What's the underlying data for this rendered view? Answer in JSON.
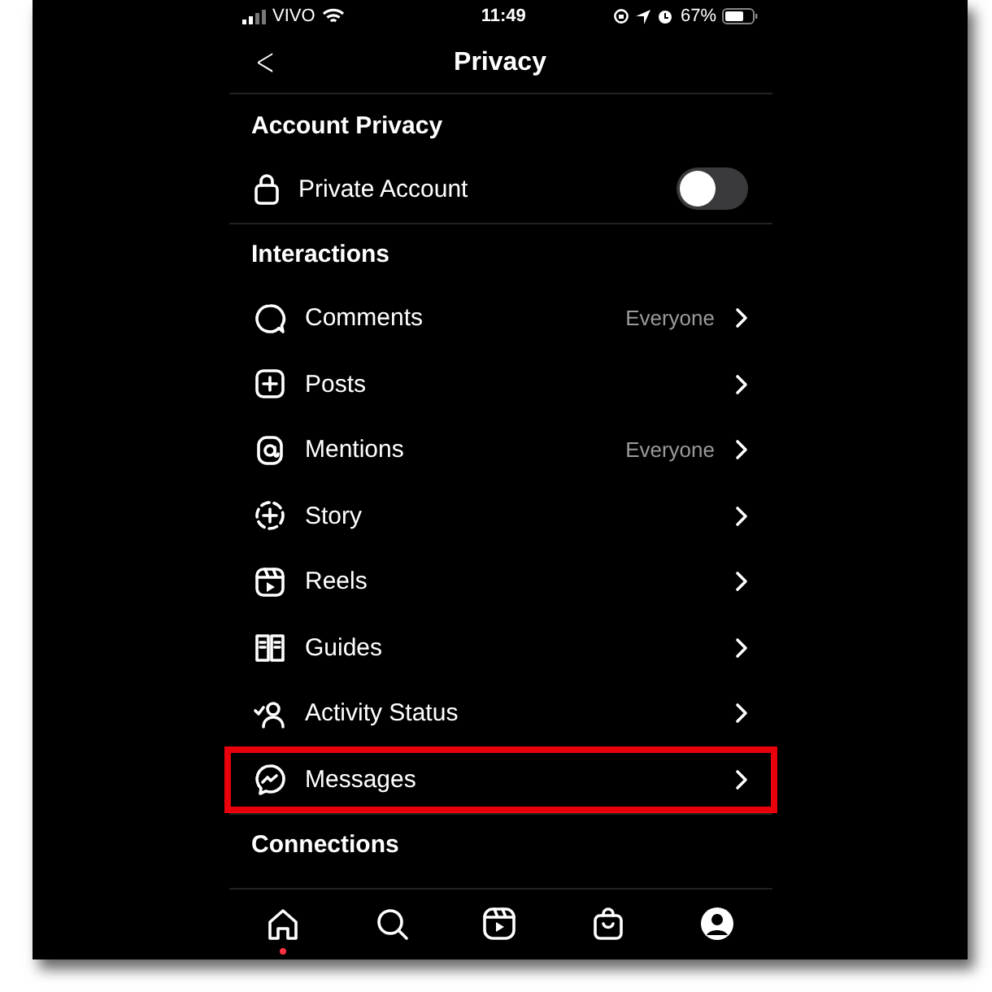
{
  "status_bar": {
    "carrier": "VIVO",
    "time": "11:49",
    "battery": "67%"
  },
  "header": {
    "back": "<",
    "title": "Privacy"
  },
  "sections": [
    {
      "title": "Account Privacy",
      "items": [
        {
          "kind": "toggle",
          "label": "Private Account",
          "on": false
        }
      ]
    },
    {
      "title": "Interactions",
      "items": [
        {
          "kind": "link",
          "label": "Comments",
          "value": "Everyone",
          "highlighted": false
        },
        {
          "kind": "link",
          "label": "Posts",
          "highlighted": false
        },
        {
          "kind": "link",
          "label": "Mentions",
          "value": "Everyone",
          "highlighted": false
        },
        {
          "kind": "link",
          "label": "Story",
          "highlighted": false
        },
        {
          "kind": "link",
          "label": "Reels",
          "highlighted": false
        },
        {
          "kind": "link",
          "label": "Guides",
          "highlighted": false
        },
        {
          "kind": "link",
          "label": "Activity Status",
          "highlighted": false
        },
        {
          "kind": "link",
          "label": "Messages",
          "highlighted": true
        }
      ]
    },
    {
      "title": "Connections"
    }
  ],
  "nav": [
    {
      "selected": true
    },
    {
      "selected": false
    },
    {
      "selected": false
    },
    {
      "selected": false
    },
    {
      "selected": false
    }
  ]
}
